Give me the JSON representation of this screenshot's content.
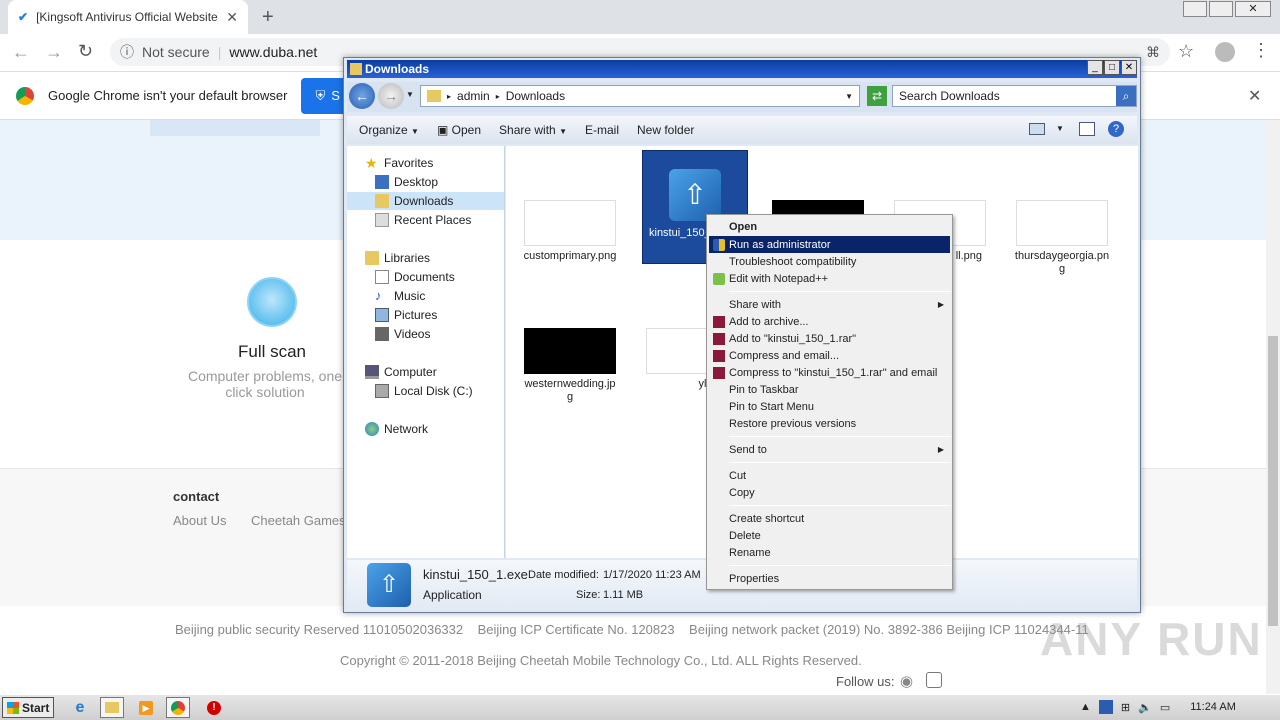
{
  "browser": {
    "tab_title": "[Kingsoft Antivirus Official Website] ",
    "security": "Not secure",
    "url": "www.duba.net",
    "infobar_text": "Google Chrome isn't your default browser",
    "infobar_button": "S"
  },
  "site": {
    "full_scan_title": "Full scan",
    "full_scan_desc_1": "Computer problems, one",
    "full_scan_desc_2": "click solution",
    "contact_heading": "contact",
    "contact_links": [
      "About Us",
      "Cheetah Games"
    ],
    "footer_line1": "Beijing public security Reserved 11010502036332    Beijing ICP Certificate No. 120823    Beijing network packet (2019) No. 3892-386 Beijing ICP 11024344-11",
    "footer_line2": "Copyright © 2011-2018 Beijing Cheetah Mobile Technology Co., Ltd. ALL Rights Reserved.",
    "follow_us": "Follow us:"
  },
  "explorer": {
    "title": "Downloads",
    "breadcrumb": [
      "admin",
      "Downloads"
    ],
    "search_placeholder": "Search Downloads",
    "toolbar": {
      "organize": "Organize",
      "open": "Open",
      "share_with": "Share with",
      "email": "E-mail",
      "new_folder": "New folder"
    },
    "nav": {
      "favorites": "Favorites",
      "desktop": "Desktop",
      "downloads": "Downloads",
      "recent": "Recent Places",
      "libraries": "Libraries",
      "documents": "Documents",
      "music": "Music",
      "pictures": "Pictures",
      "videos": "Videos",
      "computer": "Computer",
      "local_disk": "Local Disk (C:)",
      "network": "Network"
    },
    "files": {
      "f1_a": "customprimary.png",
      "f2_a": "kinstui_150_",
      "f3_a": "ll.png",
      "f4_a": "thursdaygeorgia.pn",
      "f4_b": "g",
      "f5_a": "westernwedding.jp",
      "f5_b": "g",
      "f6_a": "yland.p"
    },
    "details": {
      "name": "kinstui_150_1.exe",
      "modified_label": "Date modified:",
      "modified_value": "1/17/2020 11:23 AM",
      "type": "Application",
      "size_label": "Size:",
      "size_value": "1.11 MB"
    }
  },
  "context_menu": {
    "open": "Open",
    "run_admin": "Run as administrator",
    "troubleshoot": "Troubleshoot compatibility",
    "notepad": "Edit with Notepad++",
    "share_with": "Share with",
    "add_archive": "Add to archive...",
    "add_rar": "Add to \"kinstui_150_1.rar\"",
    "compress_email": "Compress and email...",
    "compress_rar_email": "Compress to \"kinstui_150_1.rar\" and email",
    "pin_taskbar": "Pin to Taskbar",
    "pin_start": "Pin to Start Menu",
    "restore": "Restore previous versions",
    "send_to": "Send to",
    "cut": "Cut",
    "copy": "Copy",
    "create_shortcut": "Create shortcut",
    "delete": "Delete",
    "rename": "Rename",
    "properties": "Properties"
  },
  "taskbar": {
    "start": "Start",
    "clock": "11:24 AM"
  },
  "watermark": "ANY RUN"
}
